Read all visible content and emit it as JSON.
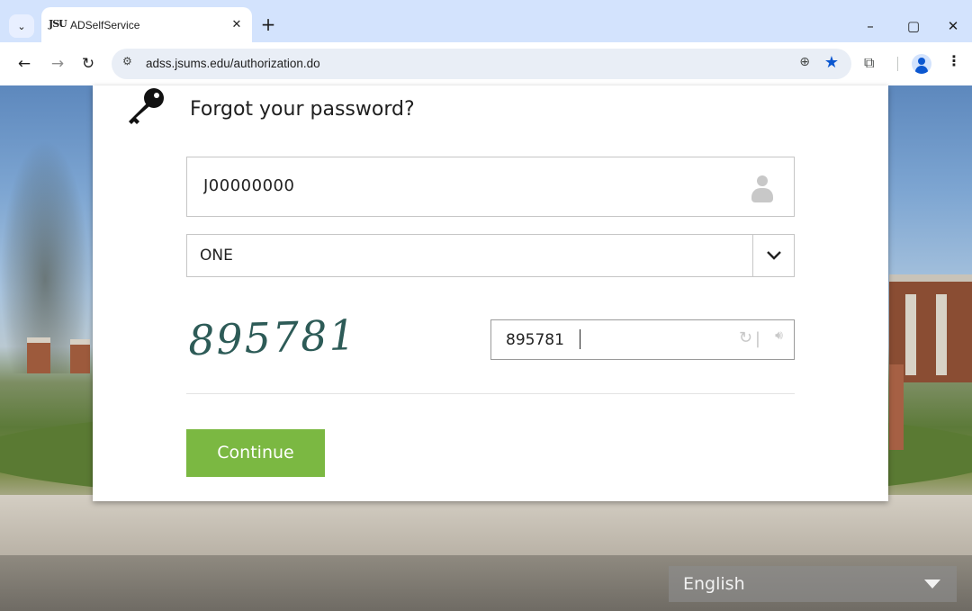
{
  "browser": {
    "tab_title": "ADSelfService",
    "tab_favicon_text": "JSU",
    "url": "adss.jsums.edu/authorization.do",
    "new_tab_label": "+",
    "close_tab_label": "✕"
  },
  "form": {
    "title": "Forgot your password?",
    "username_value": "J00000000",
    "domain_selected": "ONE",
    "captcha_text": "895781",
    "captcha_input_value": "895781",
    "continue_label": "Continue"
  },
  "language": {
    "selected": "English"
  },
  "colors": {
    "continue_button": "#7bb842",
    "bookmark_star": "#0b57d0",
    "tab_strip": "#d3e3fd"
  },
  "icons": {
    "key": "key-icon",
    "user": "user-icon",
    "refresh": "refresh-icon",
    "audio": "audio-icon"
  }
}
